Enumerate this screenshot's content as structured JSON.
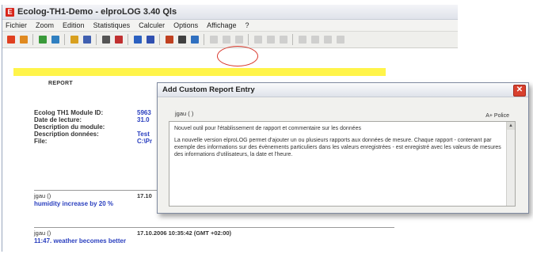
{
  "window": {
    "app_icon": "E",
    "title": "Ecolog-TH1-Demo - elproLOG 3.40 Qls"
  },
  "menu": [
    "Fichier",
    "Zoom",
    "Edition",
    "Statistiques",
    "Calculer",
    "Options",
    "Affichage",
    "?"
  ],
  "toolbar": {
    "icons": [
      {
        "name": "chart-icon-1",
        "color": "#e04020"
      },
      {
        "name": "chart-icon-2",
        "color": "#e08a20"
      },
      {
        "name": "table-icon-1",
        "color": "#3a9a3a"
      },
      {
        "name": "table-icon-2",
        "color": "#2f7fc0"
      },
      {
        "name": "open-folder-icon",
        "color": "#d8a020"
      },
      {
        "name": "save-icon",
        "color": "#4060b0"
      },
      {
        "name": "print-icon",
        "color": "#555555"
      },
      {
        "name": "print-preview-icon",
        "color": "#c03030"
      },
      {
        "name": "line-chart-icon",
        "color": "#2a60c0"
      },
      {
        "name": "grid-icon",
        "color": "#3050b0"
      },
      {
        "name": "report-icon",
        "color": "#c04020"
      },
      {
        "name": "report-entry-icon",
        "color": "#404040"
      },
      {
        "name": "report-edit-icon",
        "color": "#3070c0"
      },
      {
        "name": "disabled-icon-1",
        "color": "#b0b0b0"
      },
      {
        "name": "disabled-icon-2",
        "color": "#b0b0b0"
      },
      {
        "name": "disabled-icon-3",
        "color": "#b0b0b0"
      },
      {
        "name": "disabled-icon-4",
        "color": "#b0b0b0"
      },
      {
        "name": "disabled-icon-5",
        "color": "#b0b0b0"
      },
      {
        "name": "disabled-icon-6",
        "color": "#b0b0b0"
      },
      {
        "name": "disabled-icon-7",
        "color": "#b0b0b0"
      },
      {
        "name": "disabled-icon-8",
        "color": "#b0b0b0"
      },
      {
        "name": "disabled-icon-9",
        "color": "#b0b0b0"
      },
      {
        "name": "disabled-icon-10",
        "color": "#b0b0b0"
      }
    ]
  },
  "report": {
    "title": "REPORT",
    "fields": [
      {
        "label": "Ecolog TH1 Module ID:",
        "value": "5963"
      },
      {
        "label": "Date de lecture:",
        "value": "31.0"
      },
      {
        "label": "Description du module:",
        "value": ""
      },
      {
        "label": "Description données:",
        "value": "Test"
      },
      {
        "label": "File:",
        "value": "C:\\Pr"
      }
    ],
    "entries": [
      {
        "user": "jgau ()",
        "date": "17.10",
        "text": "humidity increase by 20 %"
      },
      {
        "user": "jgau ()",
        "date": "17.10.2006  10:35:42   (GMT +02:00)",
        "text": "11:47. weather becomes better"
      }
    ]
  },
  "dialog": {
    "title": "Add Custom Report Entry",
    "close_label": "✕",
    "user": "jgau ( )",
    "font_label": "A+ Police",
    "text_paragraphs": [
      "Nouvel outil pour l'établissement de rapport et commentaire sur les données",
      "La nouvelle version elproLOG permet d'ajouter un ou plusieurs rapports aux données de mesure. Chaque rapport - contenant par exemple des informations sur des évènements particuliers dans les valeurs enregistrées - est enregistré avec les valeurs de mesures des informations d'utilisateurs, la date et l'heure."
    ]
  }
}
